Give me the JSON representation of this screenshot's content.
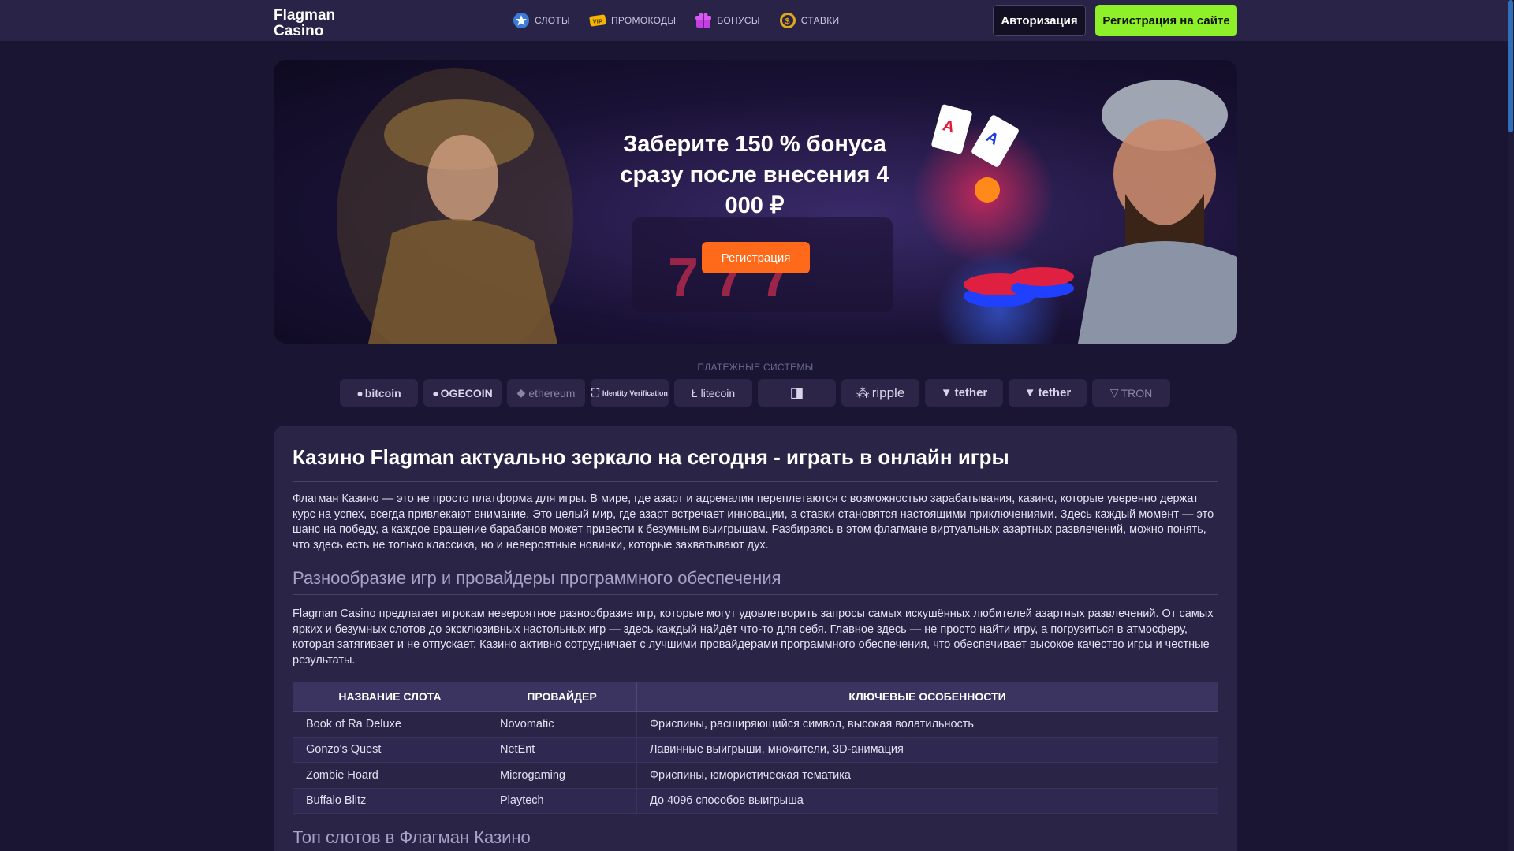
{
  "header": {
    "logo": "Flagman Casino",
    "nav": [
      {
        "label": "СЛОТЫ",
        "icon": "star-icon"
      },
      {
        "label": "ПРОМОКОДЫ",
        "icon": "vip-icon"
      },
      {
        "label": "БОНУСЫ",
        "icon": "gift-icon"
      },
      {
        "label": "СТАВКИ",
        "icon": "dollar-coin-icon"
      }
    ],
    "login_label": "Авторизация",
    "signup_label": "Регистрация на сайте"
  },
  "banner": {
    "title": "Заберите 150 % бонуса сразу после внесения 4 000 ₽",
    "button_label": "Регистрация"
  },
  "payments": {
    "title": "ПЛАТЕЖНЫЕ СИСТЕМЫ",
    "items": [
      "bitcoin",
      "OGECOIN",
      "ethereum",
      "Identity Verification",
      "litecoin",
      "",
      "ripple",
      "tether",
      "tether",
      "TRON"
    ]
  },
  "article": {
    "h1": "Казино Flagman актуально зеркало на сегодня - играть в онлайн игры",
    "p1": "Флагман Казино — это не просто платформа для игры. В мире, где азарт и адреналин переплетаются с возможностью зарабатывания, казино, которые уверенно держат курс на успех, всегда привлекают внимание. Это целый мир, где азарт встречает инновации, а ставки становятся настоящими приключениями. Здесь каждый момент — это шанс на победу, а каждое вращение барабанов может привести к безумным выигрышам. Разбираясь в этом флагмане виртуальных азартных развлечений, можно понять, что здесь есть не только классика, но и невероятные новинки, которые захватывают дух.",
    "h2": "Разнообразие игр и провайдеры программного обеспечения",
    "p2": "Flagman Casino предлагает игрокам невероятное разнообразие игр, которые могут удовлетворить запросы самых искушённых любителей азартных развлечений. От самых ярких и безумных слотов до эксклюзивных настольных игр — здесь каждый найдёт что-то для себя. Главное здесь — не просто найти игру, а погрузиться в атмосферу, которая затягивает и не отпускает. Казино активно сотрудничает с лучшими провайдерами программного обеспечения, что обеспечивает высокое качество игры и честные результаты.",
    "table": {
      "headers": [
        "НАЗВАНИЕ СЛОТА",
        "ПРОВАЙДЕР",
        "КЛЮЧЕВЫЕ ОСОБЕННОСТИ"
      ],
      "rows": [
        [
          "Book of Ra Deluxe",
          "Novomatic",
          "Фриспины, расширяющийся символ, высокая волатильность"
        ],
        [
          "Gonzo's Quest",
          "NetEnt",
          "Лавинные выигрыши, множители, 3D-анимация"
        ],
        [
          "Zombie Hoard",
          "Microgaming",
          "Фриспины, юмористическая тематика"
        ],
        [
          "Buffalo Blitz",
          "Playtech",
          "До 4096 способов выигрыша"
        ]
      ]
    },
    "h2b": "Топ слотов в Флагман Казино"
  },
  "colors": {
    "background": "#1a1533",
    "header": "#2a2348",
    "accent_green": "#8df028",
    "accent_orange": "#ff6a1a",
    "content_panel": "#2a2446"
  }
}
